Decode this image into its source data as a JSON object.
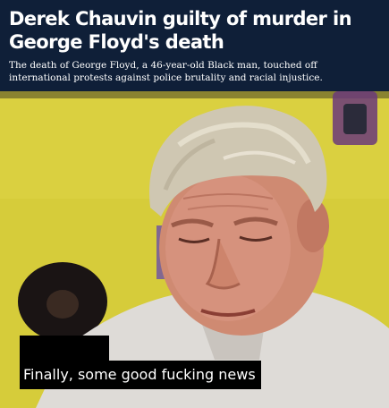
{
  "header": {
    "headline": "Derek Chauvin guilty of murder in George Floyd's death",
    "subhead": "The death of George Floyd, a 46-year-old Black man, touched off international protests against police brutality and racial injustice."
  },
  "meme": {
    "caption": "Finally, some good fucking news"
  },
  "colors": {
    "header_bg": "#0f1f38",
    "wall_yellow": "#d9cf3e",
    "caption_bg": "#000000"
  }
}
